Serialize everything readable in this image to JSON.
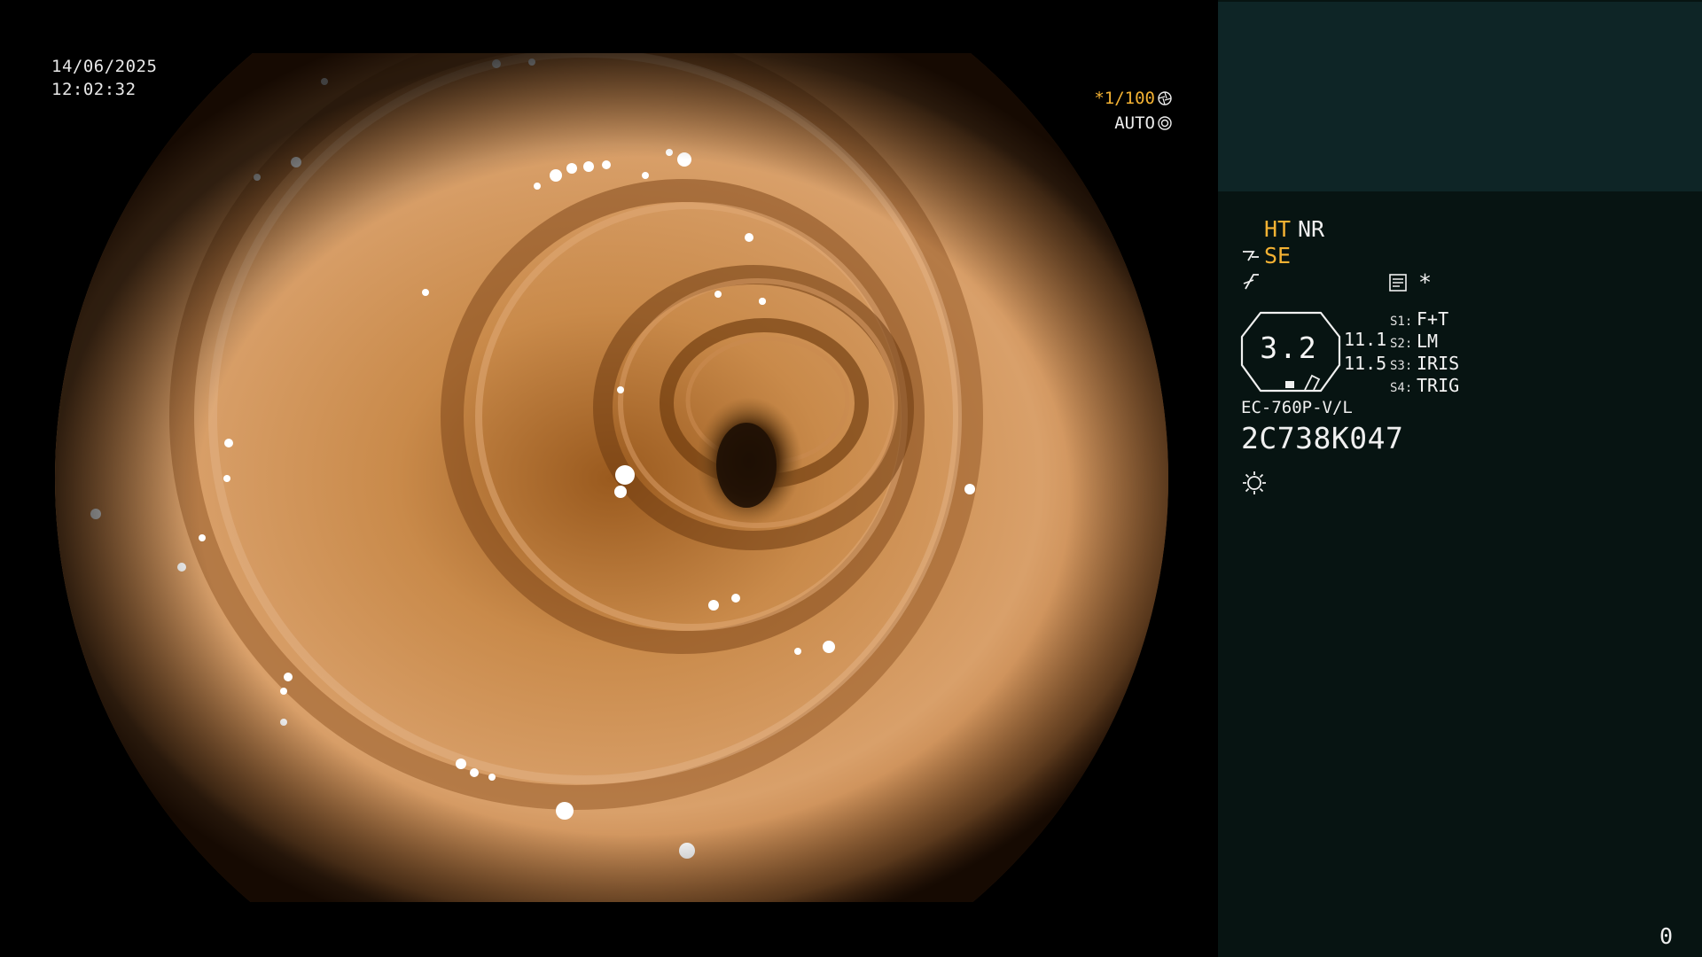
{
  "overlay": {
    "date": "14/06/2025",
    "time": "12:02:32",
    "shutter": "*1/100",
    "exposure": "AUTO",
    "icons": [
      "aperture-icon",
      "iris-icon"
    ]
  },
  "panel": {
    "mode_ht": "HT",
    "mode_nr": "NR",
    "mode_se": "SE",
    "star": "*",
    "zoom": "3.2",
    "pressure_1": "11.1",
    "pressure_2": "11.5",
    "slots": [
      {
        "key": "S1:",
        "value": "F+T"
      },
      {
        "key": "S2:",
        "value": "LM"
      },
      {
        "key": "S3:",
        "value": "IRIS"
      },
      {
        "key": "S4:",
        "value": "TRIG"
      }
    ],
    "scope_model": "EC-760P-V/L",
    "scope_serial": "2C738K047",
    "counter": "0",
    "icons": [
      "air-water-icon",
      "enhance-icon",
      "memo-icon",
      "zoom-badge-icon",
      "light-source-icon"
    ]
  },
  "colors": {
    "accent": "#f4b233",
    "panel_bg": "#071412",
    "panel_top": "#0e2526",
    "text": "#f0f0f0"
  }
}
